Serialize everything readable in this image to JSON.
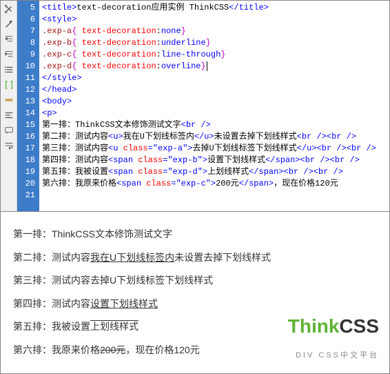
{
  "toolbar_icons": [
    "scissors-icon",
    "wand-icon",
    "outdent-icon",
    "indent-icon",
    "list-icon",
    "brackets-icon",
    "highlight-icon",
    "align-icon",
    "comment-icon",
    "wrap-icon"
  ],
  "gutter": {
    "start": 5,
    "end": 21
  },
  "code": {
    "l5": {
      "title_open": "<title>",
      "title_text": "text-decoration应用实例 ThinkCSS",
      "title_close": "</title>"
    },
    "l6": {
      "tag": "<style>"
    },
    "l7": {
      "sel": ".exp-a",
      "brace_o": "{ ",
      "prop": "text-decoration",
      "colon": ":",
      "val": "none",
      "brace_c": "}"
    },
    "l8": {
      "sel": ".exp-b",
      "brace_o": "{ ",
      "prop": "text-decoration",
      "colon": ":",
      "val": "underline",
      "brace_c": "}"
    },
    "l9": {
      "sel": ".exp-c",
      "brace_o": "{ ",
      "prop": "text-decoration",
      "colon": ":",
      "val": "line-through",
      "brace_c": "}"
    },
    "l10": {
      "sel": ".exp-d",
      "brace_o": "{ ",
      "prop": "text-decoration",
      "colon": ":",
      "val": "overline",
      "brace_c": "}"
    },
    "l11": {
      "tag": "</style>"
    },
    "l12": {
      "tag": "</head>"
    },
    "l13": {
      "tag": "<body>"
    },
    "l14": {
      "tag": "<p>"
    },
    "l15": {
      "t1": "第一排：ThinkCSS文本修饰测试文字",
      "br": "<br />"
    },
    "l16": {
      "t1": "第二排：测试内容",
      "uo": "<u>",
      "t2": "我在U下划线标签内",
      "uc": "</u>",
      "t3": "未设置去掉下划线样式",
      "br": "<br />",
      "br2": "<br />"
    },
    "l17": {
      "t1": "第三排：测试内容",
      "uo": "<u ",
      "attr": "class",
      "eq": "=",
      "q": "\"",
      "av": "exp-a",
      "q2": "\"",
      "gt": ">",
      "t2": "去掉U下划线标签下划线样式",
      "uc": "</u>",
      "br": "<br />",
      "br2": "<br />"
    },
    "l18": {
      "t1": "第四排：测试内容",
      "so": "<span ",
      "attr": "class",
      "eq": "=",
      "q": "\"",
      "av": "exp-b",
      "q2": "\"",
      "gt": ">",
      "t2": "设置下划线样式",
      "sc": "</span>",
      "br": "<br />",
      "br2": "<br />"
    },
    "l19": {
      "t1": "第五排：我被设置",
      "so": "<span ",
      "attr": "class",
      "eq": "=",
      "q": "\"",
      "av": "exp-d",
      "q2": "\"",
      "gt": ">",
      "t2": "上划线样式",
      "sc": "</span>",
      "br": "<br />",
      "br2": "<br />"
    },
    "l20": {
      "t1": "第六排：我原来价格",
      "so": "<span ",
      "attr": "class",
      "eq": "=",
      "q": "\"",
      "av": "exp-c",
      "q2": "\"",
      "gt": ">",
      "t2": "200元",
      "sc": "</span>",
      "t3": "，现在价格120元"
    }
  },
  "preview": {
    "r1": {
      "label": "第一排：",
      "text": "ThinkCSS文本修饰测试文字"
    },
    "r2": {
      "label": "第二排：",
      "t1": "测试内容",
      "u": "我在U下划线标签内",
      "t2": "未设置去掉下划线样式"
    },
    "r3": {
      "label": "第三排：",
      "t1": "测试内容",
      "u": "去掉U下划线标签下划线样式"
    },
    "r4": {
      "label": "第四排：",
      "t1": "测试内容",
      "s": "设置下划线样式"
    },
    "r5": {
      "label": "第五排：",
      "t1": "我被设置",
      "s": "上划线样式"
    },
    "r6": {
      "label": "第六排：",
      "t1": "我原来价格",
      "s": "200元",
      "t2": "，现在价格120元"
    }
  },
  "watermark": {
    "think": "Think",
    "css": "CSS",
    "sub": "DIV CSS中文平台"
  }
}
